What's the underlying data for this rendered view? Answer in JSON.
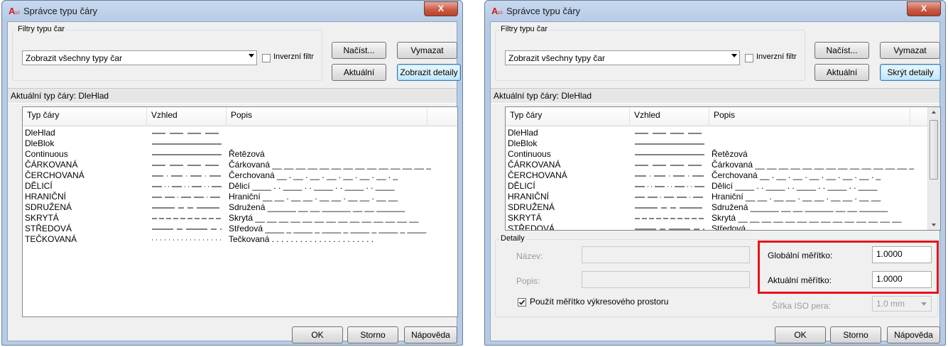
{
  "dialog_title": "Správce typu čáry",
  "close_label": "X",
  "filter": {
    "group_label": "Filtry typu čar",
    "selected": "Zobrazit všechny typy čar",
    "inverse_label": "Inverzní filtr"
  },
  "buttons": {
    "load": "Načíst...",
    "delete": "Vymazat",
    "current": "Aktuální",
    "show_details": "Zobrazit detaily",
    "hide_details": "Skrýt detaily",
    "ok": "OK",
    "cancel": "Storno",
    "help": "Nápověda"
  },
  "current_linetype": "Aktuální typ čáry:  DleHlad",
  "columns": [
    "Typ čáry",
    "Vzhled",
    "Popis"
  ],
  "linetypes": [
    {
      "name": "DleHlad",
      "pattern": "dash",
      "desc": "",
      "sample": ""
    },
    {
      "name": "DleBlok",
      "pattern": "solid",
      "desc": "",
      "sample": ""
    },
    {
      "name": "Continuous",
      "pattern": "solid",
      "desc": "Řetězová",
      "sample": ""
    },
    {
      "name": "ČÁRKOVANÁ",
      "pattern": "dash",
      "desc": "Čárkovaná",
      "sample": " __ __ __ __ __ __ __ __ __ __ __ __ __ _"
    },
    {
      "name": "ČERCHOVANÁ",
      "pattern": "dashdot",
      "desc": "Čerchovaná",
      "sample": " __ . __ . __ . __ . __ . __ . __ . _"
    },
    {
      "name": "DĚLICÍ",
      "pattern": "divide",
      "desc": "Dělicí",
      "sample": " ____ . . ____ . . ____ . . ____ . . ____"
    },
    {
      "name": "HRANIČNÍ",
      "pattern": "border",
      "desc": "Hraniční",
      "sample": " __ __ . __ __ . __ __ . __ __ . __ __"
    },
    {
      "name": "SDRUŽENÁ",
      "pattern": "phantom",
      "desc": "Sdružená",
      "sample": " ______ __ __ ______ __ __ ______"
    },
    {
      "name": "SKRYTÁ",
      "pattern": "hidden",
      "desc": "Skrytá",
      "sample": " __ __ __ __ __ __ __ __ __ __ __ __ __ __"
    },
    {
      "name": "STŘEDOVÁ",
      "pattern": "center",
      "desc": "Středová",
      "sample": " ____ _ ____ _ ____ _ ____ _ ____ _ ____"
    },
    {
      "name": "TEČKOVANÁ",
      "pattern": "dot",
      "desc": "Tečkovaná",
      "sample": " . . . . . . . . . . . . . . . . . . . . . ."
    }
  ],
  "details": {
    "group_label": "Detaily",
    "name_label": "Název:",
    "desc_label": "Popis:",
    "global_scale_label": "Globální měřítko:",
    "global_scale_value": "1.0000",
    "current_scale_label": "Aktuální měřítko:",
    "current_scale_value": "1.0000",
    "paperspace_label": "Použít měřítko výkresového prostoru",
    "iso_pen_label": "Šířka ISO pera:",
    "iso_pen_value": "1.0 mm"
  },
  "colors": {
    "highlight": "#e2161c",
    "title_bar": "#b6cbe6",
    "focus": "#3c7fb1"
  }
}
